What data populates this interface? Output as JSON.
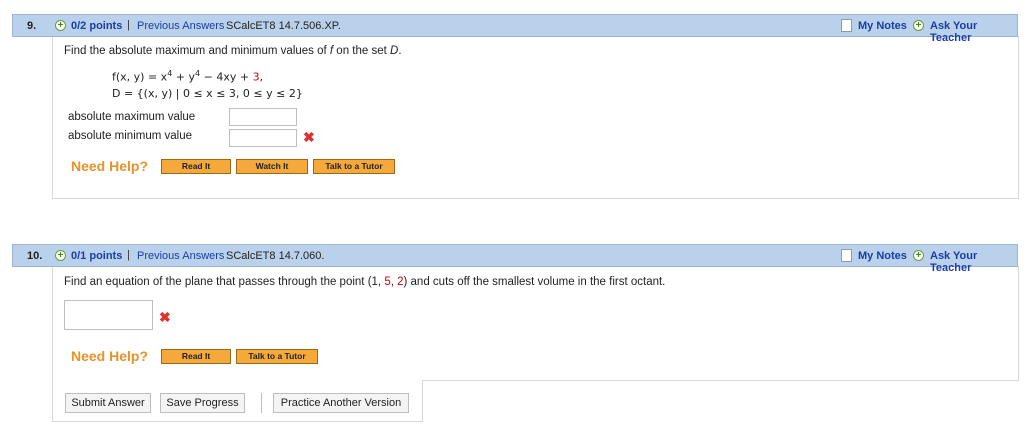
{
  "q9": {
    "number": "9.",
    "points": "0/2 points",
    "sep": "|",
    "previous_answers": "Previous Answers",
    "ref": "SCalcET8 14.7.506.XP.",
    "my_notes": "My Notes",
    "ask_teacher": "Ask Your Teacher",
    "prompt_a": "Find the absolute maximum and minimum values of ",
    "prompt_f": "f",
    "prompt_b": " on the set ",
    "prompt_d": "D",
    "prompt_c": ".",
    "func_lhs": "f(x, y) = x",
    "func_exp1": "4",
    "func_mid": " + y",
    "func_exp2": "4",
    "func_rest": " − 4xy + ",
    "func_const": "3",
    "func_end": ",",
    "set_def": "D = {(x, y) | 0 ≤ x ≤ 3, 0 ≤ y ≤ 2}",
    "max_label": "absolute maximum value",
    "min_label": "absolute minimum value",
    "max_value": "",
    "min_value": "",
    "need_help": "Need Help?",
    "btn_read": "Read It",
    "btn_watch": "Watch It",
    "btn_tutor": "Talk to a Tutor"
  },
  "q10": {
    "number": "10.",
    "points": "0/1 points",
    "sep": "|",
    "previous_answers": "Previous Answers",
    "ref": "SCalcET8 14.7.060.",
    "my_notes": "My Notes",
    "ask_teacher": "Ask Your Teacher",
    "prompt_a": "Find an equation of the plane that passes through the point (1, ",
    "pt_y": "5",
    "prompt_b": ", ",
    "pt_z": "2",
    "prompt_c": ") and cuts off the smallest volume in the first octant.",
    "answer_value": "",
    "need_help": "Need Help?",
    "btn_read": "Read It",
    "btn_tutor": "Talk to a Tutor"
  },
  "footer": {
    "submit": "Submit Answer",
    "save": "Save Progress",
    "practice": "Practice Another Version"
  },
  "colors": {
    "header_bg": "#b9d1ea",
    "link": "#1a3da8",
    "need_help": "#e8922a",
    "help_btn": "#f6a93b",
    "error_x": "#e03030",
    "highlight_red": "#cc0000"
  }
}
